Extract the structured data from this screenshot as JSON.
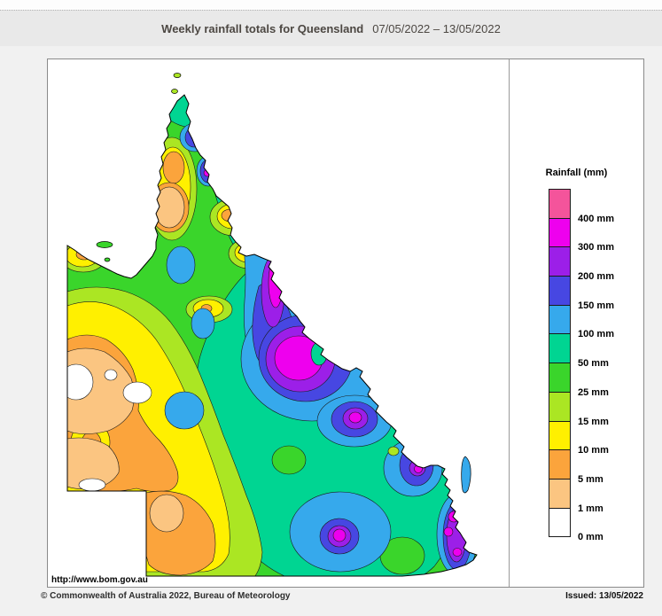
{
  "page": {
    "header": {
      "title": "Weekly rainfall totals for Queensland",
      "date_range": "07/05/2022 – 13/05/2022"
    },
    "map": {
      "region": "Queensland",
      "url_watermark": "http://www.bom.gov.au"
    },
    "legend": {
      "title": "Rainfall (mm)",
      "bands": [
        {
          "label": "400 mm",
          "key": "p400"
        },
        {
          "label": "300 mm",
          "key": "p300"
        },
        {
          "label": "200 mm",
          "key": "p200"
        },
        {
          "label": "150 mm",
          "key": "p150"
        },
        {
          "label": "100 mm",
          "key": "p100"
        },
        {
          "label": "50 mm",
          "key": "p50"
        },
        {
          "label": "25 mm",
          "key": "p25"
        },
        {
          "label": "15 mm",
          "key": "p15"
        },
        {
          "label": "10 mm",
          "key": "p10"
        },
        {
          "label": "5 mm",
          "key": "p5"
        },
        {
          "label": "1 mm",
          "key": "p1"
        },
        {
          "label": "0 mm",
          "key": "p0"
        }
      ]
    },
    "footer": {
      "copyright": "© Commonwealth of Australia 2022, Bureau of Meteorology",
      "issued": "Issued: 13/05/2022"
    }
  },
  "palette": {
    "p400": "#F4549B",
    "p300": "#EE00EE",
    "p200": "#9C1FE8",
    "p150": "#4747E2",
    "p100": "#36A9EC",
    "p50": "#00D592",
    "p25": "#3AD52B",
    "p15": "#ABE623",
    "p10": "#FFF000",
    "p5": "#FBA43C",
    "p1": "#FBC581",
    "p0": "#FFFFFF"
  }
}
